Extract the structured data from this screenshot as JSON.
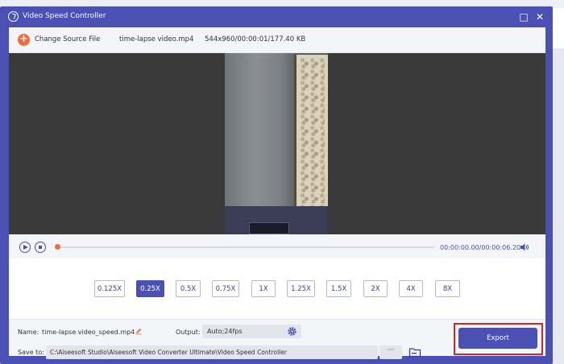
{
  "window": {
    "title": "Video Speed Controller"
  },
  "source": {
    "change_label": "Change Source File",
    "file_name": "time-lapse video.mp4",
    "file_info": "544x960/00:00:01/177.40 KB"
  },
  "player": {
    "time": "00:00:00.00/00:00:06.20",
    "progress": 0
  },
  "speeds": [
    {
      "label": "0.125X",
      "active": false
    },
    {
      "label": "0.25X",
      "active": true
    },
    {
      "label": "0.5X",
      "active": false
    },
    {
      "label": "0.75X",
      "active": false
    },
    {
      "label": "1X",
      "active": false
    },
    {
      "label": "1.25X",
      "active": false
    },
    {
      "label": "1.5X",
      "active": false
    },
    {
      "label": "2X",
      "active": false
    },
    {
      "label": "4X",
      "active": false
    },
    {
      "label": "8X",
      "active": false
    }
  ],
  "output": {
    "name_label": "Name:",
    "name_value": "time-lapse video_speed.mp4",
    "output_label": "Output:",
    "output_value": "Auto;24fps",
    "save_label": "Save to:",
    "save_path": "C:\\Aiseesoft Studio\\Aiseesoft Video Converter Ultimate\\Video Speed Controller",
    "browse_label": "···",
    "export_label": "Export"
  },
  "colors": {
    "accent": "#4b50b5",
    "orange": "#f06a40",
    "highlight": "#d02828"
  }
}
